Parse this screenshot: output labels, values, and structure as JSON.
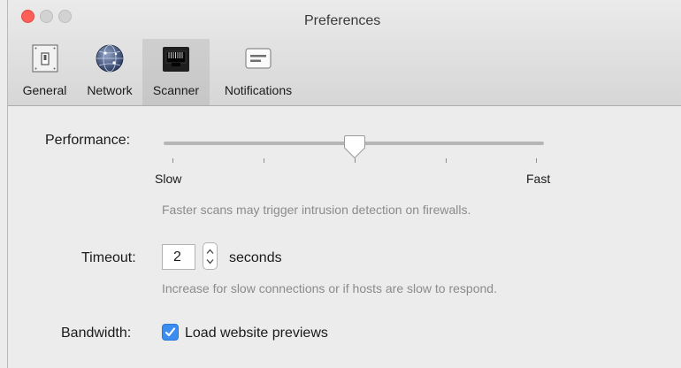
{
  "window": {
    "title": "Preferences"
  },
  "tabs": [
    {
      "label": "General",
      "icon": "general-icon"
    },
    {
      "label": "Network",
      "icon": "network-icon"
    },
    {
      "label": "Scanner",
      "icon": "scanner-icon",
      "selected": true
    },
    {
      "label": "Notifications",
      "icon": "notifications-icon"
    }
  ],
  "performance": {
    "label": "Performance:",
    "min_label": "Slow",
    "max_label": "Fast",
    "value_fraction": 0.5,
    "tick_count": 5,
    "hint": "Faster scans may trigger intrusion detection on firewalls."
  },
  "timeout": {
    "label": "Timeout:",
    "value": "2",
    "unit": "seconds",
    "hint": "Increase for slow connections or if hosts are slow to respond."
  },
  "bandwidth": {
    "label": "Bandwidth:",
    "checkbox_label": "Load website previews",
    "checked": true
  },
  "colors": {
    "accent": "#3b8df0",
    "close": "#fc5f57"
  }
}
